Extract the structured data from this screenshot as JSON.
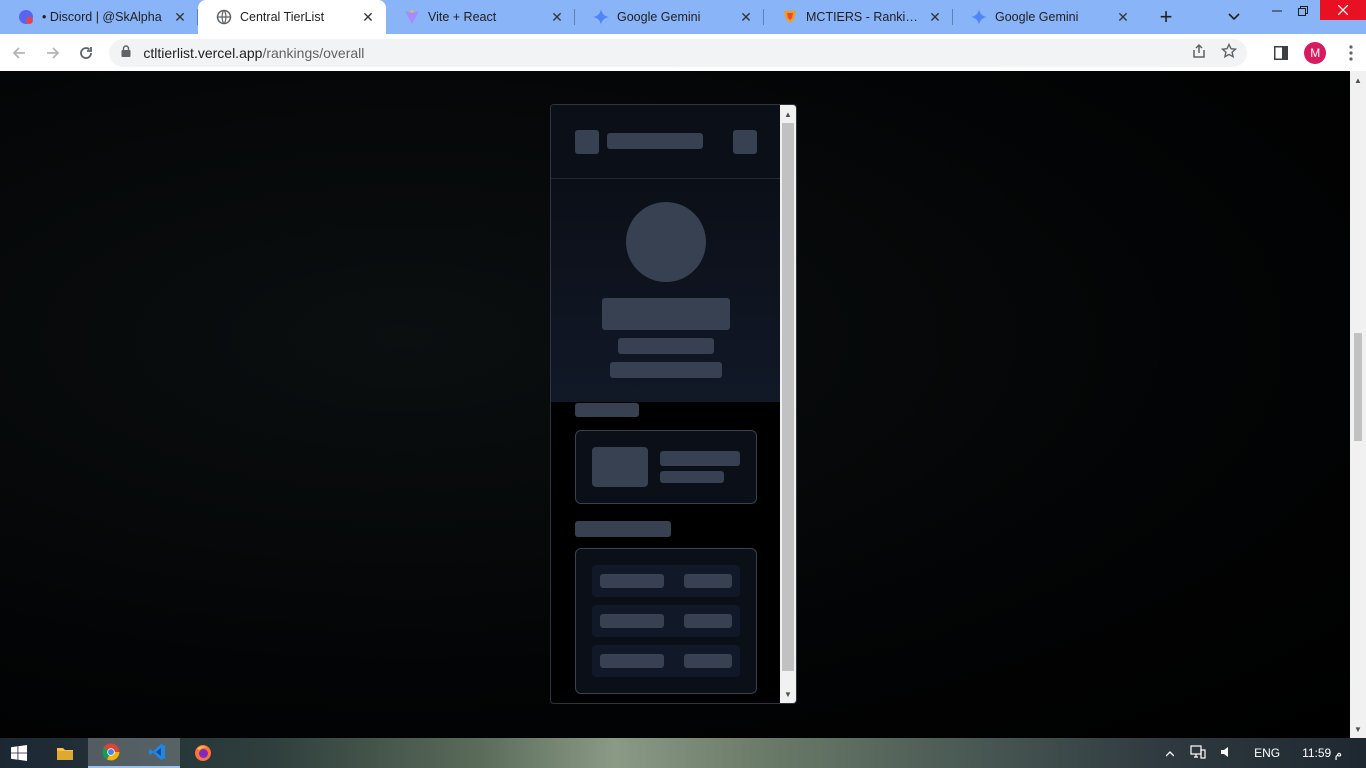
{
  "browser": {
    "tabs": [
      {
        "title": "• Discord | @SkAlpha",
        "icon": "discord-icon",
        "active": false
      },
      {
        "title": "Central TierList",
        "icon": "globe-icon",
        "active": true
      },
      {
        "title": "Vite + React",
        "icon": "vite-icon",
        "active": false
      },
      {
        "title": "Google Gemini",
        "icon": "gemini-icon",
        "active": false
      },
      {
        "title": "MCTIERS - Rankings",
        "icon": "mctiers-icon",
        "active": false
      },
      {
        "title": "Google Gemini",
        "icon": "gemini-icon",
        "active": false
      }
    ],
    "url_host": "ctltierlist.vercel.app",
    "url_path": "/rankings/overall",
    "profile_initial": "M"
  },
  "taskbar": {
    "language": "ENG",
    "time": "11:59 م"
  },
  "colors": {
    "tab_strip": "#8ab4f8",
    "skeleton": "#374151",
    "page_background": "#000000",
    "close_button": "#e81123",
    "profile": "#d81b60"
  }
}
